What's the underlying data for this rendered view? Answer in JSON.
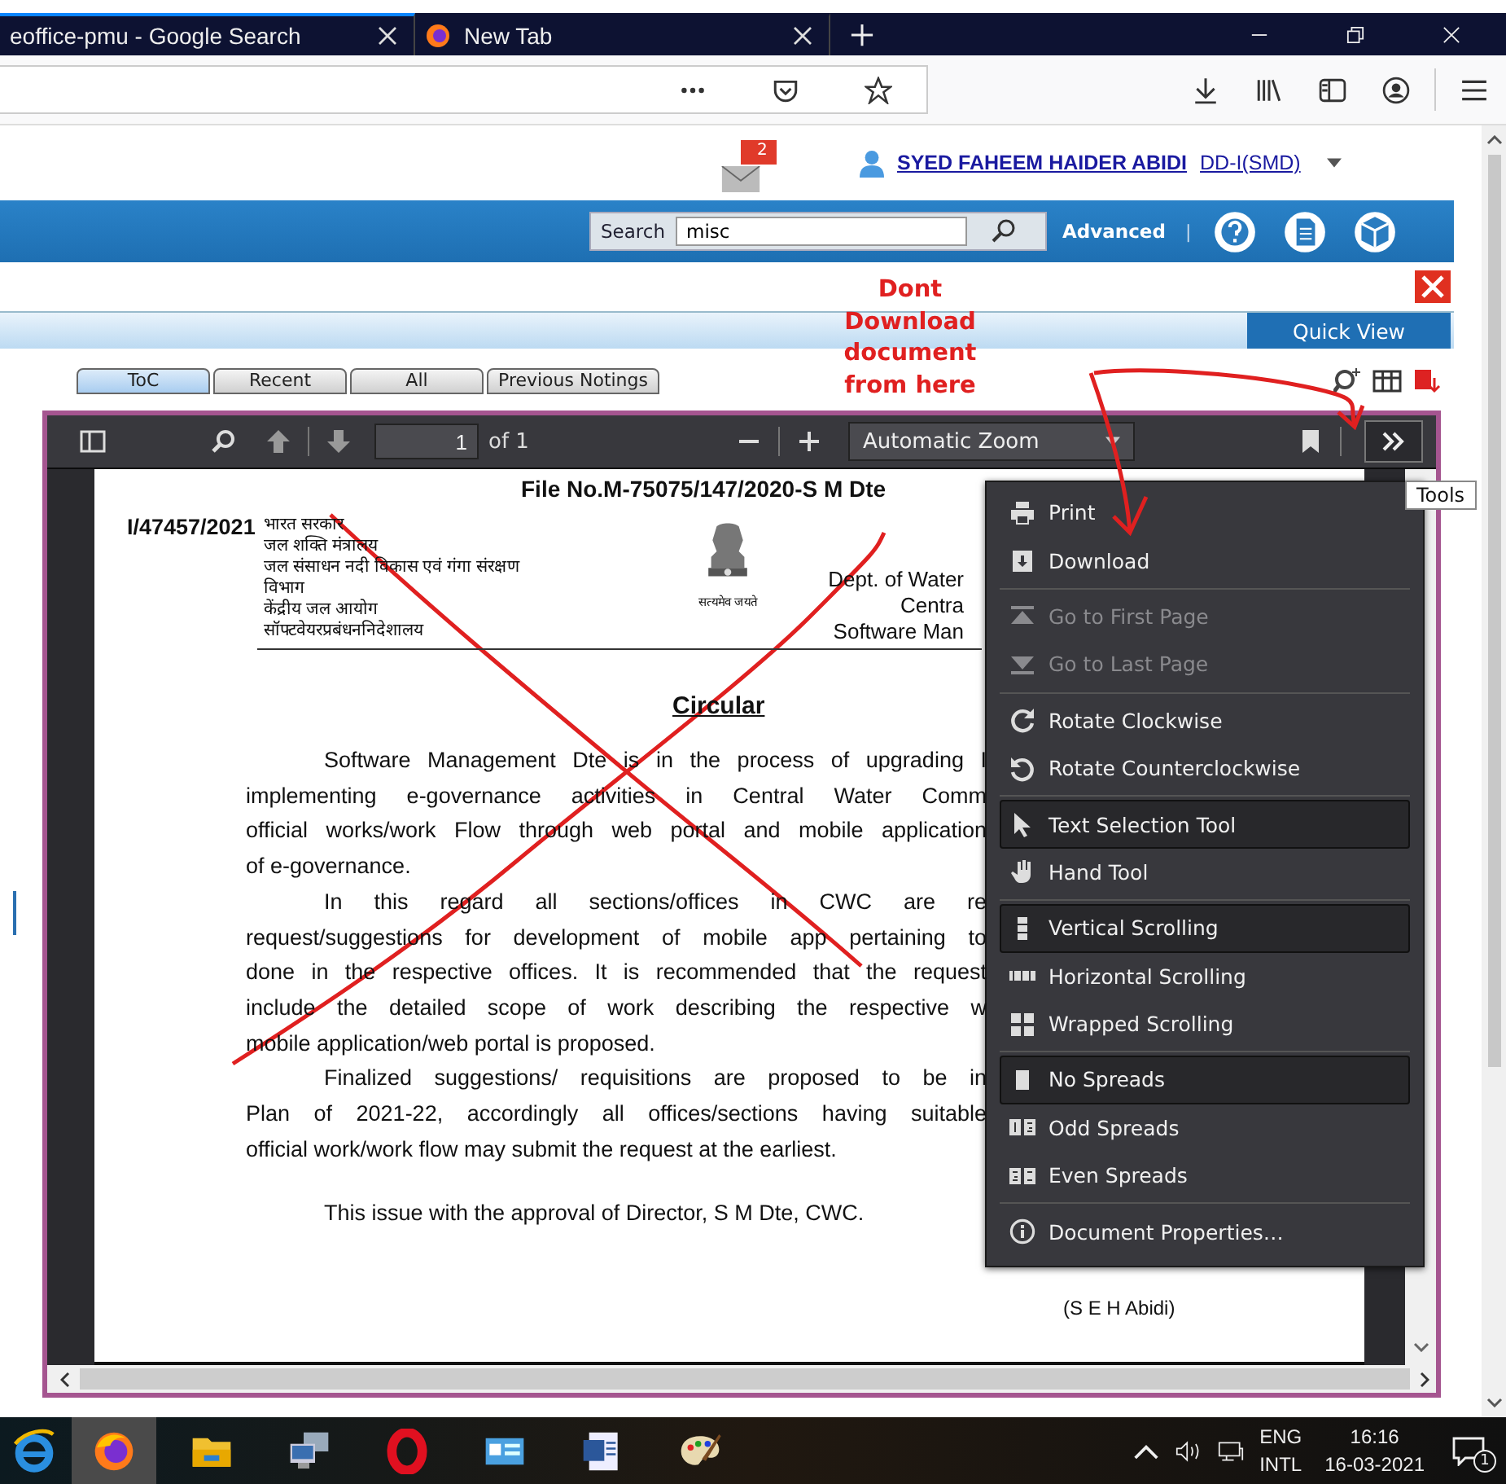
{
  "browser": {
    "tabs": [
      {
        "label": "eoffice-pmu - Google Search",
        "selected": true
      },
      {
        "label": "New Tab",
        "selected": false
      }
    ]
  },
  "header": {
    "mail_badge": "2",
    "user_name": "SYED FAHEEM HAIDER ABIDI",
    "user_role": "DD-I(SMD)"
  },
  "search_bar": {
    "label": "Search",
    "value": "misc",
    "advanced": "Advanced",
    "separator": "|"
  },
  "annotation": {
    "text": "Dont Download document from here"
  },
  "quick_view": "Quick View",
  "doc_tabs": [
    {
      "label": "ToC",
      "selected": true
    },
    {
      "label": "Recent",
      "selected": false
    },
    {
      "label": "All",
      "selected": false
    },
    {
      "label": "Previous Notings",
      "selected": false
    }
  ],
  "pdf_toolbar": {
    "page": "1",
    "page_count": "of 1",
    "zoom": "Automatic Zoom",
    "tooltip": "Tools"
  },
  "document": {
    "file_no": "File No.M-75075/147/2020-S M Dte",
    "ref": "I/47457/2021",
    "hindi_lines": [
      "भारत सरकार",
      "जल शक्ति मंत्रालय",
      "जल संसाधन नदी विकास एवं गंगा संरक्षण",
      "विभाग",
      "केंद्रीय जल आयोग",
      "सॉफ्टवेयरप्रबंधननिदेशालय"
    ],
    "motto": "सत्यमेव जयते",
    "english_lines": [
      "Dept. of Water",
      "Centra",
      "Software Man"
    ],
    "title": "Circular",
    "paragraphs": [
      {
        "lines": [
          "Software Management Dte is in the process of upgrading I",
          "implementing e-governance activities in Central Water Comm",
          "official works/work Flow through web portal and mobile application",
          "of e-governance."
        ]
      },
      {
        "lines": [
          "In this regard all sections/offices in CWC are re",
          "request/suggestions for development of mobile app pertaining to",
          "done in the respective offices. It is recommended that the request",
          "include the detailed scope of work describing the respective w",
          "mobile application/web portal is proposed."
        ]
      },
      {
        "lines": [
          "Finalized suggestions/ requisitions are proposed to be in",
          "Plan of 2021-22, accordingly all offices/sections having suitable",
          "official work/work flow may submit the request at the earliest."
        ]
      }
    ],
    "closing": "This issue with the approval of Director, S M Dte, CWC.",
    "signature": "(S E H Abidi)"
  },
  "tools_menu": {
    "groups": [
      {
        "items": [
          {
            "label": "Print",
            "disabled": false
          },
          {
            "label": "Download",
            "disabled": false
          }
        ]
      },
      {
        "items": [
          {
            "label": "Go to First Page",
            "disabled": true
          },
          {
            "label": "Go to Last Page",
            "disabled": true
          }
        ]
      },
      {
        "items": [
          {
            "label": "Rotate Clockwise",
            "disabled": false
          },
          {
            "label": "Rotate Counterclockwise",
            "disabled": false
          }
        ]
      },
      {
        "items": [
          {
            "label": "Text Selection Tool",
            "disabled": false,
            "selected": true
          },
          {
            "label": "Hand Tool",
            "disabled": false,
            "selected": false
          }
        ]
      },
      {
        "items": [
          {
            "label": "Vertical Scrolling",
            "disabled": false,
            "selected": true
          },
          {
            "label": "Horizontal Scrolling",
            "disabled": false,
            "selected": false
          },
          {
            "label": "Wrapped Scrolling",
            "disabled": false,
            "selected": false
          }
        ]
      },
      {
        "items": [
          {
            "label": "No Spreads",
            "disabled": false,
            "selected": true
          },
          {
            "label": "Odd Spreads",
            "disabled": false,
            "selected": false
          },
          {
            "label": "Even Spreads",
            "disabled": false,
            "selected": false
          }
        ]
      },
      {
        "items": [
          {
            "label": "Document Properties…",
            "disabled": false
          }
        ]
      }
    ]
  },
  "taskbar": {
    "apps": [
      {
        "selected": false
      },
      {
        "selected": true
      },
      {
        "selected": false
      },
      {
        "selected": false
      },
      {
        "selected": false
      },
      {
        "selected": false
      },
      {
        "selected": false
      },
      {
        "selected": false
      }
    ]
  },
  "tray": {
    "language": "ENG",
    "layout": "INTL",
    "time": "16:16",
    "date": "16-03-2021",
    "notifications": "1"
  }
}
